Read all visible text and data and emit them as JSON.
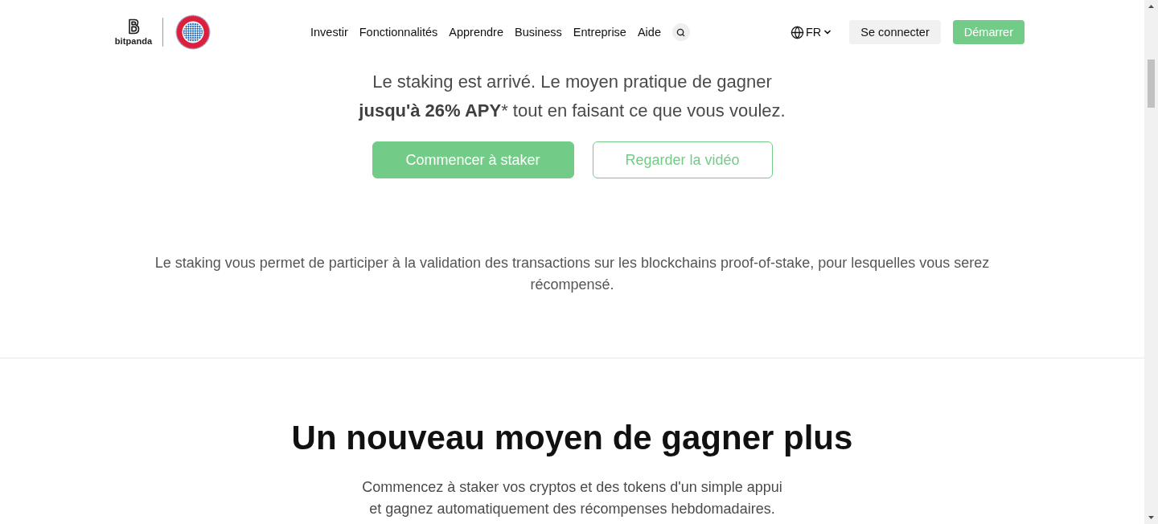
{
  "header": {
    "brand": {
      "wordmark": "bitpanda"
    },
    "nav": [
      "Investir",
      "Fonctionnalités",
      "Apprendre",
      "Business",
      "Entreprise",
      "Aide"
    ],
    "language": "FR",
    "buttons": [
      {
        "label": "Se connecter",
        "kind": "secondary"
      },
      {
        "label": "Démarrer",
        "kind": "primary"
      }
    ]
  },
  "hero": {
    "tagline": "Le staking est arrivé. Le moyen pratique de gagner **jusqu'à 26% APY*** tout en faisant ce que vous voulez.",
    "buttons": [
      {
        "label": "Commencer à staker",
        "kind": "primary"
      },
      {
        "label": "Regarder la vidéo",
        "kind": "outline"
      }
    ],
    "description": "Le staking vous permet de participer à la validation des transactions sur les blockchains proof-of-stake, pour lesquelles vous serez récompensé."
  },
  "features": {
    "title": "Un nouveau moyen de gagner plus",
    "subtitle": "Commencez à staker vos cryptos et des tokens d'un simple appui et gagnez automatiquement des récompenses hebdomadaires."
  }
}
